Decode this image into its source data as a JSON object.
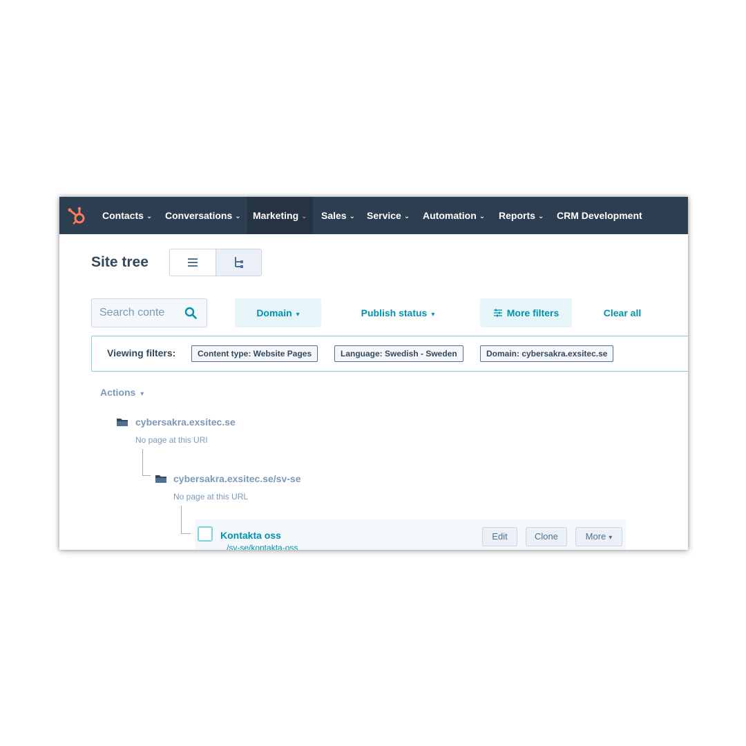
{
  "nav": {
    "items": [
      {
        "label": "Contacts",
        "caret": "⌄"
      },
      {
        "label": "Conversations",
        "caret": "⌄"
      },
      {
        "label": "Marketing",
        "caret": "⌄"
      },
      {
        "label": "Sales",
        "caret": "⌄"
      },
      {
        "label": "Service",
        "caret": "⌄"
      },
      {
        "label": "Automation",
        "caret": "⌄"
      },
      {
        "label": "Reports",
        "caret": "⌄"
      },
      {
        "label": "CRM Development"
      }
    ],
    "active": "Marketing",
    "logo_icon": "hubspot-sprocket-icon"
  },
  "page": {
    "title": "Site tree",
    "view_toggle": {
      "list_icon": "list-view-icon",
      "tree_icon": "tree-view-icon",
      "selected": "tree"
    }
  },
  "filters": {
    "search_placeholder": "Search conte",
    "domain_label": "Domain",
    "publish_status_label": "Publish status",
    "more_filters_label": "More filters",
    "clear_all_label": "Clear all",
    "dropdown_caret": "▾"
  },
  "viewing_filters": {
    "label": "Viewing filters:",
    "chips": [
      "Content type: Website Pages",
      "Language: Swedish - Sweden",
      "Domain: cybersakra.exsitec.se"
    ]
  },
  "actions": {
    "label": "Actions",
    "caret": "▾"
  },
  "tree": {
    "root": {
      "title": "cybersakra.exsitec.se",
      "subtitle": "No page at this URI"
    },
    "child": {
      "title": "cybersakra.exsitec.se/sv-se",
      "subtitle": "No page at this URL"
    },
    "page": {
      "title": "Kontakta oss",
      "url": "/sv-se/kontakta-oss",
      "buttons": {
        "edit": "Edit",
        "clone": "Clone",
        "more": "More"
      }
    }
  },
  "colors": {
    "nav_bg": "#2d3e50",
    "accent": "#0091ae",
    "brand_orange": "#ff7a59",
    "muted": "#7c98b6"
  }
}
